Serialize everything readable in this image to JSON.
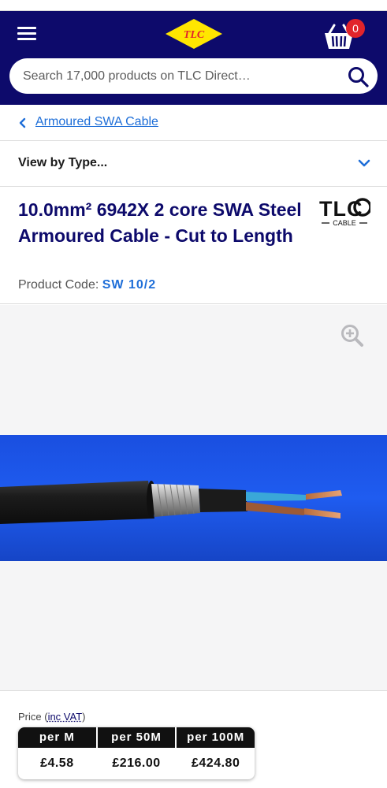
{
  "header": {
    "logo_text": "TLC",
    "basket_count": "0",
    "brand_colors": {
      "navy": "#0d0a6b",
      "yellow": "#ffe600",
      "red": "#e2242b"
    },
    "search": {
      "placeholder": "Search 17,000 products on TLC Direct…"
    }
  },
  "breadcrumb": {
    "label": "Armoured SWA Cable"
  },
  "filter": {
    "label": "View by Type..."
  },
  "product": {
    "title": "10.0mm² 6942X 2 core SWA Steel Armoured Cable - Cut to Length",
    "code_label": "Product Code:",
    "code_value": "SW 10/2",
    "brand_logo_text": "TLC",
    "brand_logo_sub": "CABLE"
  },
  "gallery": {
    "icon": "zoom-in-icon"
  },
  "pricing": {
    "label_prefix": "Price (",
    "vat_label": "inc VAT",
    "label_suffix": ")",
    "columns": [
      {
        "header": "per M",
        "price": "£4.58"
      },
      {
        "header": "per 50M",
        "price": "£216.00"
      },
      {
        "header": "per 100M",
        "price": "£424.80"
      }
    ]
  }
}
